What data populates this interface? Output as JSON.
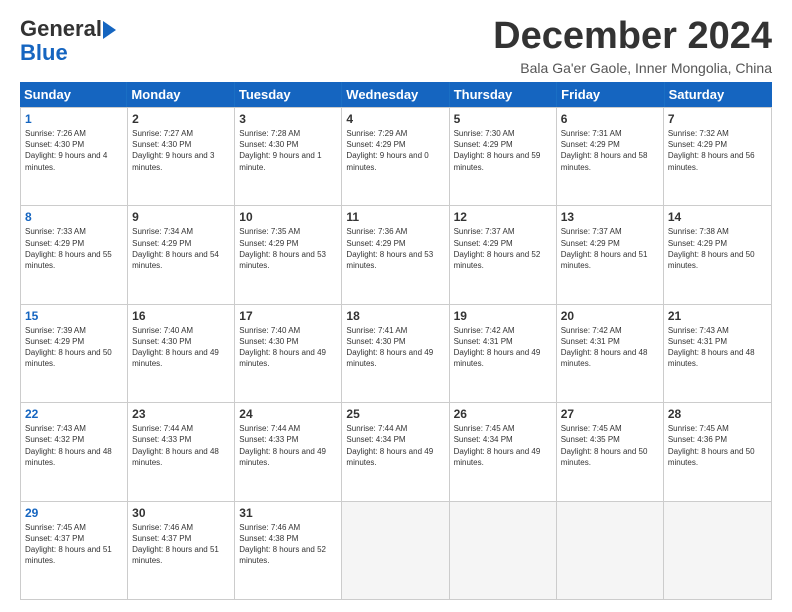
{
  "logo": {
    "line1": "General",
    "line2": "Blue"
  },
  "title": "December 2024",
  "location": "Bala Ga'er Gaole, Inner Mongolia, China",
  "days_of_week": [
    "Sunday",
    "Monday",
    "Tuesday",
    "Wednesday",
    "Thursday",
    "Friday",
    "Saturday"
  ],
  "weeks": [
    [
      {
        "day": "1",
        "sunrise": "7:26 AM",
        "sunset": "4:30 PM",
        "daylight": "9 hours and 4 minutes.",
        "type": "sunday"
      },
      {
        "day": "2",
        "sunrise": "7:27 AM",
        "sunset": "4:30 PM",
        "daylight": "9 hours and 3 minutes.",
        "type": ""
      },
      {
        "day": "3",
        "sunrise": "7:28 AM",
        "sunset": "4:30 PM",
        "daylight": "9 hours and 1 minute.",
        "type": ""
      },
      {
        "day": "4",
        "sunrise": "7:29 AM",
        "sunset": "4:29 PM",
        "daylight": "9 hours and 0 minutes.",
        "type": ""
      },
      {
        "day": "5",
        "sunrise": "7:30 AM",
        "sunset": "4:29 PM",
        "daylight": "8 hours and 59 minutes.",
        "type": ""
      },
      {
        "day": "6",
        "sunrise": "7:31 AM",
        "sunset": "4:29 PM",
        "daylight": "8 hours and 58 minutes.",
        "type": ""
      },
      {
        "day": "7",
        "sunrise": "7:32 AM",
        "sunset": "4:29 PM",
        "daylight": "8 hours and 56 minutes.",
        "type": ""
      }
    ],
    [
      {
        "day": "8",
        "sunrise": "7:33 AM",
        "sunset": "4:29 PM",
        "daylight": "8 hours and 55 minutes.",
        "type": "sunday"
      },
      {
        "day": "9",
        "sunrise": "7:34 AM",
        "sunset": "4:29 PM",
        "daylight": "8 hours and 54 minutes.",
        "type": ""
      },
      {
        "day": "10",
        "sunrise": "7:35 AM",
        "sunset": "4:29 PM",
        "daylight": "8 hours and 53 minutes.",
        "type": ""
      },
      {
        "day": "11",
        "sunrise": "7:36 AM",
        "sunset": "4:29 PM",
        "daylight": "8 hours and 53 minutes.",
        "type": ""
      },
      {
        "day": "12",
        "sunrise": "7:37 AM",
        "sunset": "4:29 PM",
        "daylight": "8 hours and 52 minutes.",
        "type": ""
      },
      {
        "day": "13",
        "sunrise": "7:37 AM",
        "sunset": "4:29 PM",
        "daylight": "8 hours and 51 minutes.",
        "type": ""
      },
      {
        "day": "14",
        "sunrise": "7:38 AM",
        "sunset": "4:29 PM",
        "daylight": "8 hours and 50 minutes.",
        "type": ""
      }
    ],
    [
      {
        "day": "15",
        "sunrise": "7:39 AM",
        "sunset": "4:29 PM",
        "daylight": "8 hours and 50 minutes.",
        "type": "sunday"
      },
      {
        "day": "16",
        "sunrise": "7:40 AM",
        "sunset": "4:30 PM",
        "daylight": "8 hours and 49 minutes.",
        "type": ""
      },
      {
        "day": "17",
        "sunrise": "7:40 AM",
        "sunset": "4:30 PM",
        "daylight": "8 hours and 49 minutes.",
        "type": ""
      },
      {
        "day": "18",
        "sunrise": "7:41 AM",
        "sunset": "4:30 PM",
        "daylight": "8 hours and 49 minutes.",
        "type": ""
      },
      {
        "day": "19",
        "sunrise": "7:42 AM",
        "sunset": "4:31 PM",
        "daylight": "8 hours and 49 minutes.",
        "type": ""
      },
      {
        "day": "20",
        "sunrise": "7:42 AM",
        "sunset": "4:31 PM",
        "daylight": "8 hours and 48 minutes.",
        "type": ""
      },
      {
        "day": "21",
        "sunrise": "7:43 AM",
        "sunset": "4:31 PM",
        "daylight": "8 hours and 48 minutes.",
        "type": ""
      }
    ],
    [
      {
        "day": "22",
        "sunrise": "7:43 AM",
        "sunset": "4:32 PM",
        "daylight": "8 hours and 48 minutes.",
        "type": "sunday"
      },
      {
        "day": "23",
        "sunrise": "7:44 AM",
        "sunset": "4:33 PM",
        "daylight": "8 hours and 48 minutes.",
        "type": ""
      },
      {
        "day": "24",
        "sunrise": "7:44 AM",
        "sunset": "4:33 PM",
        "daylight": "8 hours and 49 minutes.",
        "type": ""
      },
      {
        "day": "25",
        "sunrise": "7:44 AM",
        "sunset": "4:34 PM",
        "daylight": "8 hours and 49 minutes.",
        "type": ""
      },
      {
        "day": "26",
        "sunrise": "7:45 AM",
        "sunset": "4:34 PM",
        "daylight": "8 hours and 49 minutes.",
        "type": ""
      },
      {
        "day": "27",
        "sunrise": "7:45 AM",
        "sunset": "4:35 PM",
        "daylight": "8 hours and 50 minutes.",
        "type": ""
      },
      {
        "day": "28",
        "sunrise": "7:45 AM",
        "sunset": "4:36 PM",
        "daylight": "8 hours and 50 minutes.",
        "type": ""
      }
    ],
    [
      {
        "day": "29",
        "sunrise": "7:45 AM",
        "sunset": "4:37 PM",
        "daylight": "8 hours and 51 minutes.",
        "type": "sunday"
      },
      {
        "day": "30",
        "sunrise": "7:46 AM",
        "sunset": "4:37 PM",
        "daylight": "8 hours and 51 minutes.",
        "type": ""
      },
      {
        "day": "31",
        "sunrise": "7:46 AM",
        "sunset": "4:38 PM",
        "daylight": "8 hours and 52 minutes.",
        "type": ""
      },
      {
        "day": "",
        "type": "empty"
      },
      {
        "day": "",
        "type": "empty"
      },
      {
        "day": "",
        "type": "empty"
      },
      {
        "day": "",
        "type": "empty"
      }
    ]
  ]
}
